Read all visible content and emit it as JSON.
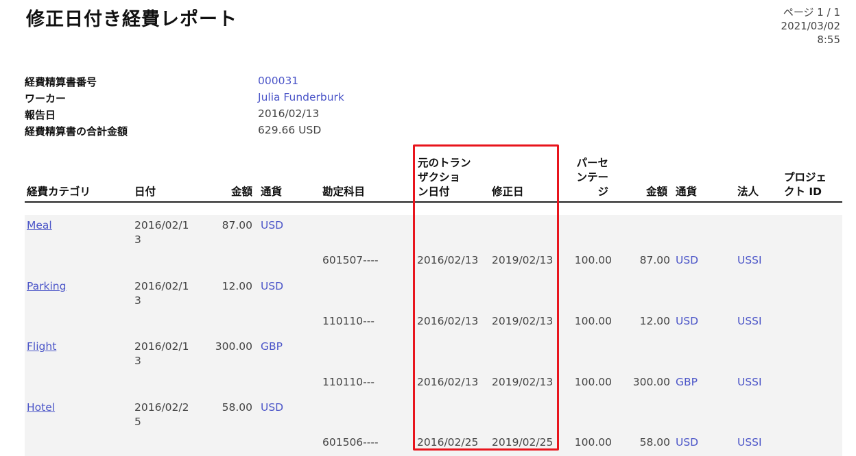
{
  "title": "修正日付き経費レポート",
  "page_info": {
    "page": "ページ 1 / 1",
    "date": "2021/03/02",
    "time": "8:55"
  },
  "summary": [
    {
      "label": "経費精算書番号",
      "value": "000031",
      "link": true
    },
    {
      "label": "ワーカー",
      "value": "Julia Funderburk",
      "link": true
    },
    {
      "label": "報告日",
      "value": "2016/02/13",
      "link": false
    },
    {
      "label": "経費精算書の合計金額",
      "value": "629.66 USD",
      "link": false
    }
  ],
  "columns": {
    "category": "経費カテゴリ",
    "date": "日付",
    "amount": "金額",
    "currency": "通貨",
    "account": "勘定科目",
    "orig_date_l1": "元のトラン",
    "orig_date_l2": "ザクショ",
    "orig_date_l3": "ン日付",
    "modified_date": "修正日",
    "percent_l1": "パーセ",
    "percent_l2": "ンテー",
    "percent_l3": "ジ",
    "amount2": "金額",
    "currency2": "通貨",
    "entity": "法人",
    "project_l1": "プロジェ",
    "project_l2": "クト ID"
  },
  "rows": [
    {
      "category": "Meal",
      "date_l1": "2016/02/1",
      "date_l2": "3",
      "amount": "87.00",
      "currency": "USD",
      "account": "601507----",
      "orig_date": "2016/02/13",
      "modified_date": "2019/02/13",
      "percent": "100.00",
      "amount2": "87.00",
      "currency2": "USD",
      "entity": "USSI"
    },
    {
      "category": "Parking",
      "date_l1": "2016/02/1",
      "date_l2": "3",
      "amount": "12.00",
      "currency": "USD",
      "account": "110110---",
      "orig_date": "2016/02/13",
      "modified_date": "2019/02/13",
      "percent": "100.00",
      "amount2": "12.00",
      "currency2": "USD",
      "entity": "USSI"
    },
    {
      "category": "Flight",
      "date_l1": "2016/02/1",
      "date_l2": "3",
      "amount": "300.00",
      "currency": "GBP",
      "account": "110110---",
      "orig_date": "2016/02/13",
      "modified_date": "2019/02/13",
      "percent": "100.00",
      "amount2": "300.00",
      "currency2": "GBP",
      "entity": "USSI"
    },
    {
      "category": "Hotel",
      "date_l1": "2016/02/2",
      "date_l2": "5",
      "amount": "58.00",
      "currency": "USD",
      "account": "601506----",
      "orig_date": "2016/02/25",
      "modified_date": "2019/02/25",
      "percent": "100.00",
      "amount2": "58.00",
      "currency2": "USD",
      "entity": "USSI"
    }
  ],
  "colors": {
    "link": "#4b55c8",
    "highlight_border": "#e8141c",
    "row_background": "#f3f3f3"
  }
}
